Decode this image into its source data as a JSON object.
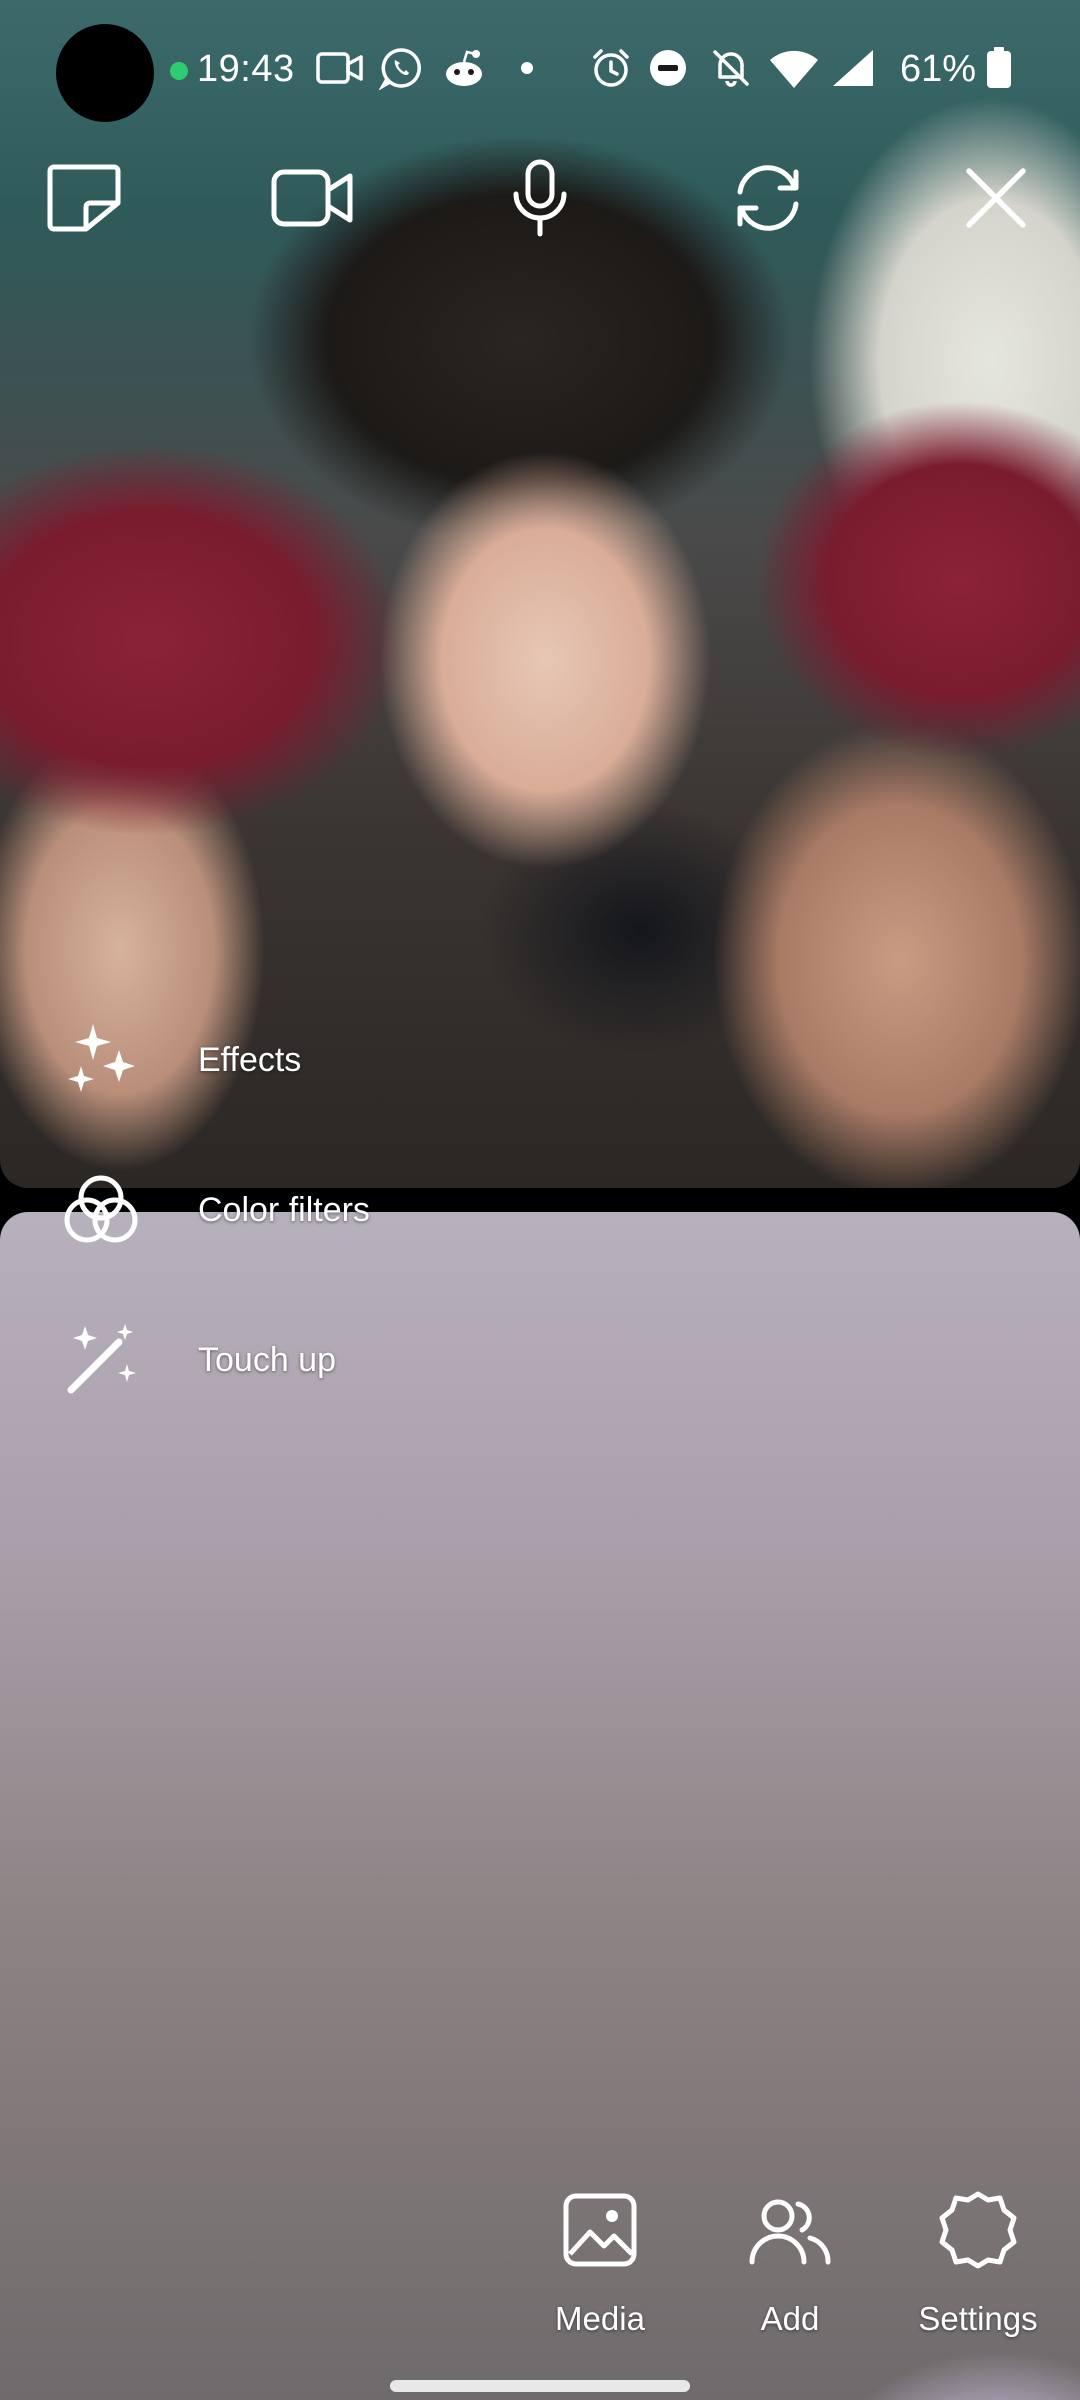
{
  "status_bar": {
    "time": "19:43",
    "battery": "61%",
    "icons": [
      "video-recording-icon",
      "whatsapp-icon",
      "reddit-icon",
      "dot-icon",
      "alarm-icon",
      "do-not-disturb-icon",
      "bell-muted-icon",
      "wifi-icon",
      "signal-icon",
      "battery-icon"
    ],
    "indicator_color": "#2ecc71"
  },
  "top_controls": [
    {
      "name": "layout-toggle",
      "icon": "layout-icon"
    },
    {
      "name": "video-toggle",
      "icon": "video-camera-icon"
    },
    {
      "name": "microphone-toggle",
      "icon": "microphone-icon"
    },
    {
      "name": "flip-camera",
      "icon": "flip-camera-icon"
    },
    {
      "name": "end-call",
      "icon": "close-icon"
    }
  ],
  "side_menu": {
    "effects_label": "Effects",
    "color_filters_label": "Color filters",
    "touch_up_label": "Touch up"
  },
  "bottom_actions": {
    "media_label": "Media",
    "add_label": "Add",
    "settings_label": "Settings"
  },
  "colors": {
    "icon": "#ffffff",
    "background": "#000000"
  }
}
